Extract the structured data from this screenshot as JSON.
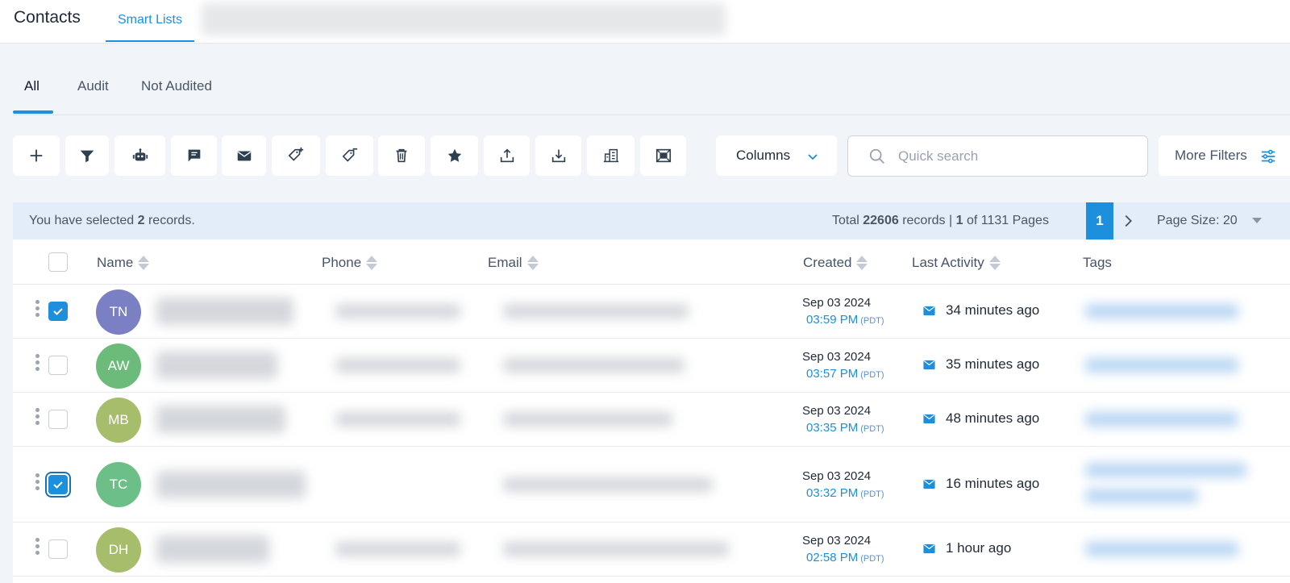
{
  "header": {
    "title": "Contacts",
    "tab_smart_lists": "Smart Lists"
  },
  "subtabs": [
    {
      "label": "All",
      "active": true
    },
    {
      "label": "Audit",
      "active": false
    },
    {
      "label": "Not Audited",
      "active": false
    }
  ],
  "toolbar": {
    "icons": [
      "plus-icon",
      "filter-icon",
      "robot-icon",
      "chat-icon",
      "mail-icon",
      "add-tag-icon",
      "remove-tag-icon",
      "trash-icon",
      "star-icon",
      "export-icon",
      "import-icon",
      "building-icon",
      "merge-icon"
    ],
    "columns_label": "Columns",
    "search_placeholder": "Quick search",
    "more_filters_label": "More Filters"
  },
  "selection": {
    "prefix": "You have selected ",
    "count": "2",
    "suffix": " records.",
    "total_prefix": "Total ",
    "total_records": "22606",
    "total_mid": " records | ",
    "current_page": "1",
    "total_of": " of 1131 Pages",
    "page_button": "1",
    "page_size_label": "Page Size: 20"
  },
  "table": {
    "headers": {
      "name": "Name",
      "phone": "Phone",
      "email": "Email",
      "created": "Created",
      "last_activity": "Last Activity",
      "tags": "Tags"
    },
    "rows": [
      {
        "initials": "TN",
        "avatar_color": "#7b7fc4",
        "checked": true,
        "date": "Sep 03 2024",
        "time": "03:59 PM",
        "tz": "(PDT)",
        "activity": "34 minutes ago"
      },
      {
        "initials": "AW",
        "avatar_color": "#6cbb7a",
        "checked": false,
        "date": "Sep 03 2024",
        "time": "03:57 PM",
        "tz": "(PDT)",
        "activity": "35 minutes ago"
      },
      {
        "initials": "MB",
        "avatar_color": "#a6bd6c",
        "checked": false,
        "date": "Sep 03 2024",
        "time": "03:35 PM",
        "tz": "(PDT)",
        "activity": "48 minutes ago"
      },
      {
        "initials": "TC",
        "avatar_color": "#6cbf86",
        "checked": true,
        "date": "Sep 03 2024",
        "time": "03:32 PM",
        "tz": "(PDT)",
        "activity": "16 minutes ago"
      },
      {
        "initials": "DH",
        "avatar_color": "#a6bd6c",
        "checked": false,
        "date": "Sep 03 2024",
        "time": "02:58 PM",
        "tz": "(PDT)",
        "activity": "1 hour ago"
      }
    ]
  },
  "colors": {
    "accent": "#1d8fdd",
    "background": "#f1f5f9",
    "selection_bar": "#e2edf9"
  }
}
